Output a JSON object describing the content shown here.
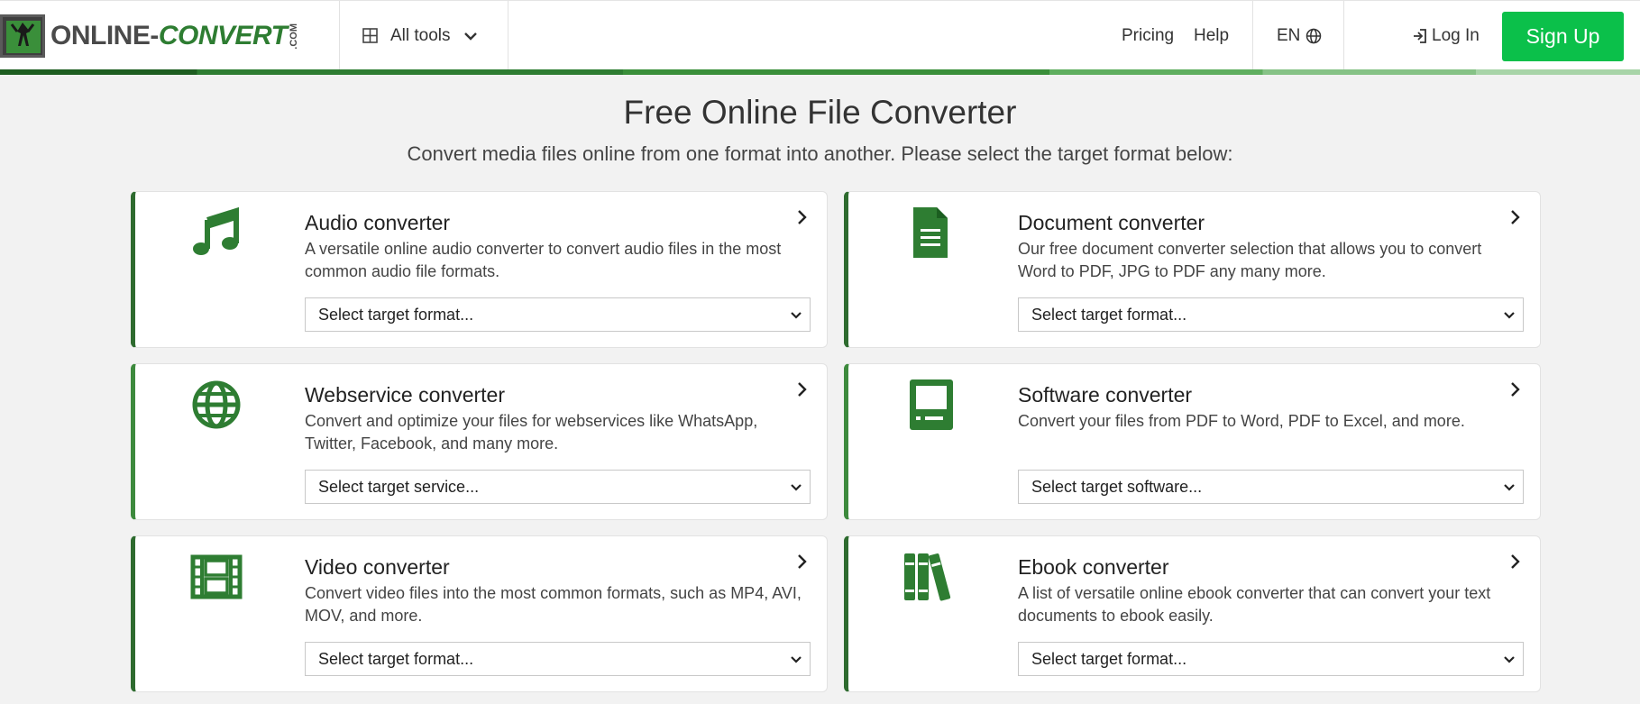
{
  "header": {
    "logo_text_main": "ONLINE-",
    "logo_text_green": "CONVERT",
    "logo_text_com": ".COM",
    "all_tools_label": "All tools",
    "pricing_label": "Pricing",
    "help_label": "Help",
    "language_label": "EN",
    "login_label": "Log In",
    "signup_label": "Sign Up"
  },
  "hero": {
    "title": "Free Online File Converter",
    "subtitle": "Convert media files online from one format into another. Please select the target format below:"
  },
  "cards": [
    {
      "title": "Audio converter",
      "description": "A versatile online audio converter to convert audio files in the most common audio file formats.",
      "select": "Select target format...",
      "icon": "music-note-icon"
    },
    {
      "title": "Document converter",
      "description": "Our free document converter selection that allows you to convert Word to PDF, JPG to PDF any many more.",
      "select": "Select target format...",
      "icon": "document-icon"
    },
    {
      "title": "Webservice converter",
      "description": "Convert and optimize your files for webservices like WhatsApp, Twitter, Facebook, and many more.",
      "select": "Select target service...",
      "icon": "globe-icon"
    },
    {
      "title": "Software converter",
      "description": "Convert your files from PDF to Word, PDF to Excel, and more.",
      "select": "Select target software...",
      "icon": "computer-icon"
    },
    {
      "title": "Video converter",
      "description": "Convert video files into the most common formats, such as MP4, AVI, MOV, and more.",
      "select": "Select target format...",
      "icon": "film-icon"
    },
    {
      "title": "Ebook converter",
      "description": "A list of versatile online ebook converter that can convert your text documents to ebook easily.",
      "select": "Select target format...",
      "icon": "books-icon"
    }
  ],
  "colors": {
    "accent_green": "#2e7d32",
    "signup_green": "#0bc04a"
  }
}
